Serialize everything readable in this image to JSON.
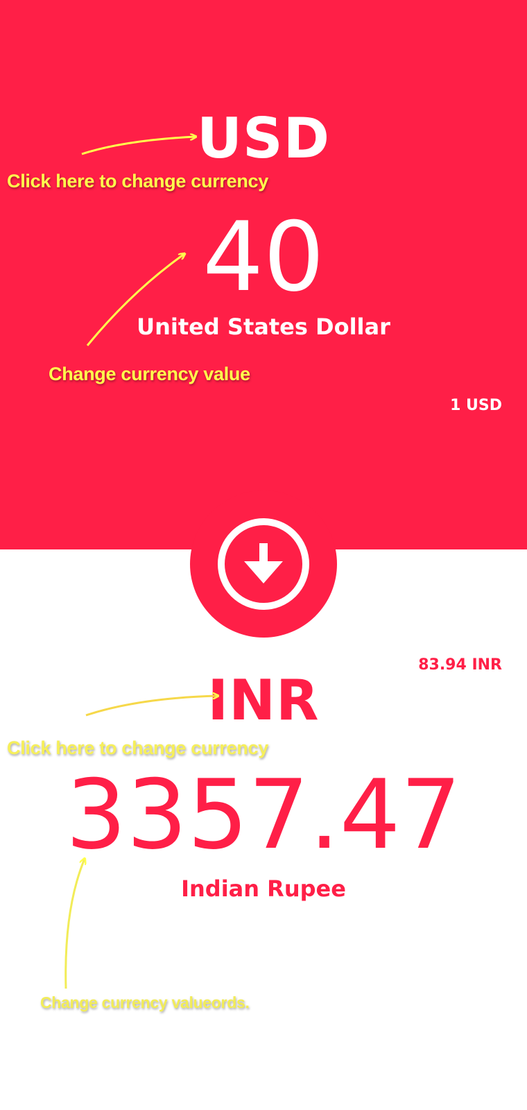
{
  "from": {
    "code": "USD",
    "amount": "40",
    "name": "United States Dollar",
    "rate": "1 USD"
  },
  "to": {
    "code": "INR",
    "amount": "3357.47",
    "name": "Indian Rupee",
    "rate": "83.94 INR"
  },
  "swap": {
    "icon": "arrow-down-circle-icon"
  },
  "hints": {
    "change_currency_top": "Click here to change currency",
    "change_value_top": "Change currency value",
    "change_currency_bottom": "Click here to change currency",
    "change_value_bottom": "Change currency valueords."
  },
  "colors": {
    "accent": "#ff1f47",
    "background": "#ffffff",
    "annotation": "#ffff4d"
  }
}
